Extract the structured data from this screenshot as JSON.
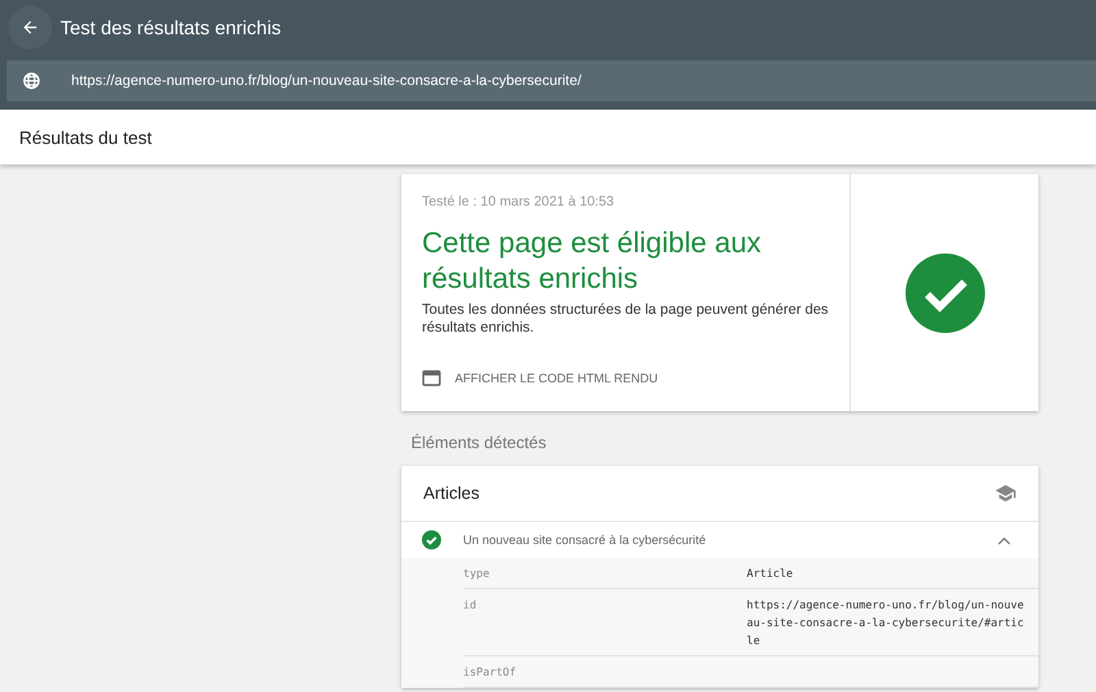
{
  "app_bar": {
    "title": "Test des résultats enrichis",
    "url": "https://agence-numero-uno.fr/blog/un-nouveau-site-consacre-a-la-cybersecurite/"
  },
  "header": {
    "title": "Résultats du test"
  },
  "summary": {
    "tested": "Testé le : 10 mars 2021 à 10:53",
    "headline": "Cette page est éligible aux résultats enrichis",
    "description": "Toutes les données structurées de la page peuvent générer des résultats enrichis.",
    "action": "AFFICHER LE CODE HTML RENDU",
    "valid": true
  },
  "detected": {
    "title": "Éléments détectés",
    "sections": [
      {
        "title": "Articles",
        "items": [
          {
            "title": "Un nouveau site consacré à la cybersécurité",
            "valid": true,
            "expanded": true,
            "properties": [
              {
                "key": "type",
                "value": "Article"
              },
              {
                "key": "id",
                "value": "https://agence-numero-uno.fr/blog/un-nouveau-site-consacre-a-la-cybersecurite/#article"
              },
              {
                "key": "isPartOf"
              }
            ]
          }
        ]
      }
    ]
  }
}
